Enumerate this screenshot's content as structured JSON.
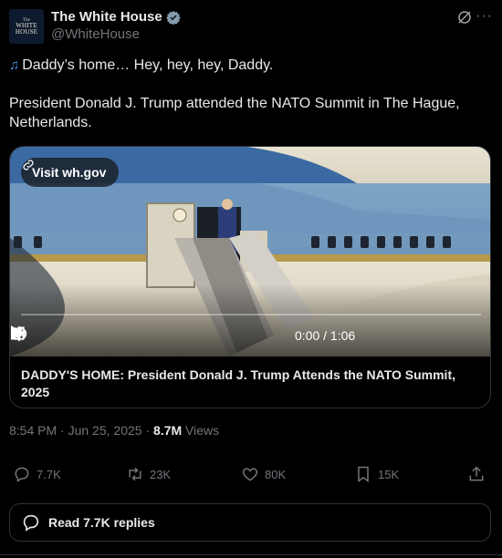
{
  "account": {
    "avatar_line1": "The",
    "avatar_line2": "WHITE",
    "avatar_line3": "HOUSE",
    "name": "The White House",
    "handle": "@WhiteHouse",
    "verified_badge_color": "#829aab"
  },
  "tweet": {
    "line1": "Daddy’s home… Hey, hey, hey, Daddy.",
    "line2": "President Donald J. Trump attended the NATO Summit in The Hague, Netherlands.",
    "music_icon": "musical-notes-icon"
  },
  "card": {
    "visit_label": "Visit wh.gov",
    "time": "0:00 / 1:06",
    "title": "DADDY'S HOME: President Donald J. Trump Attends the NATO Summit, 2025"
  },
  "meta": {
    "time": "8:54 PM",
    "date": "Jun 25, 2025",
    "views_count": "8.7M",
    "views_label": "Views"
  },
  "actions": {
    "replies": "7.7K",
    "reposts": "23K",
    "likes": "80K",
    "bookmarks": "15K"
  },
  "read_replies_label": "Read 7.7K replies",
  "colors": {
    "background": "#000000",
    "text": "#e7e9ea",
    "muted": "#71767b",
    "border": "#2f3336"
  }
}
